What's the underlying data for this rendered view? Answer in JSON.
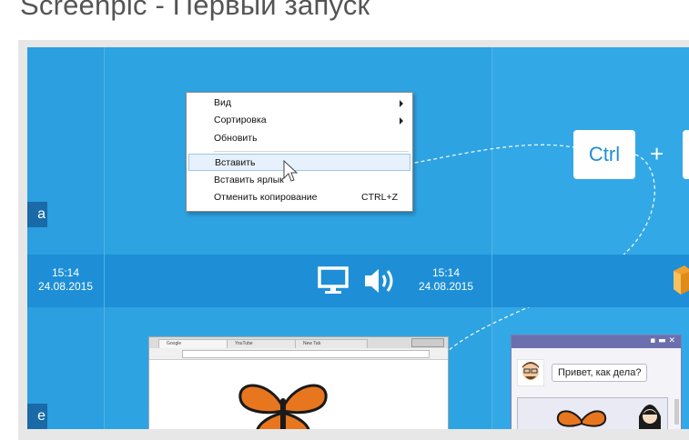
{
  "page": {
    "title": "Screenpic - Первый запуск"
  },
  "left_column": {
    "tag_top": "а",
    "tag_bottom": "е"
  },
  "context_menu": {
    "items": [
      {
        "label": "Вид",
        "submenu": true
      },
      {
        "label": "Сортировка",
        "submenu": true
      },
      {
        "label": "Обновить"
      },
      {
        "label": "Вставить",
        "highlighted": true
      },
      {
        "label": "Вставить ярлык"
      },
      {
        "label": "Отменить копирование",
        "shortcut": "CTRL+Z"
      }
    ]
  },
  "shortcut_keys": {
    "ctrl": "Ctrl",
    "plus": "+"
  },
  "taskbar": {
    "clock_left": {
      "time": "15:14",
      "date": "24.08.2015"
    },
    "clock_center": {
      "time": "15:14",
      "date": "24.08.2015"
    }
  },
  "browser": {
    "tabs": [
      "Google",
      "YouTube",
      "New Tab"
    ]
  },
  "chat": {
    "message": "Привет, как дела?"
  },
  "colors": {
    "stage": "#2ea3e2",
    "taskbar": "#1e8fd6",
    "key_text": "#1f8fd4",
    "logo_orange": "#f0a030"
  }
}
